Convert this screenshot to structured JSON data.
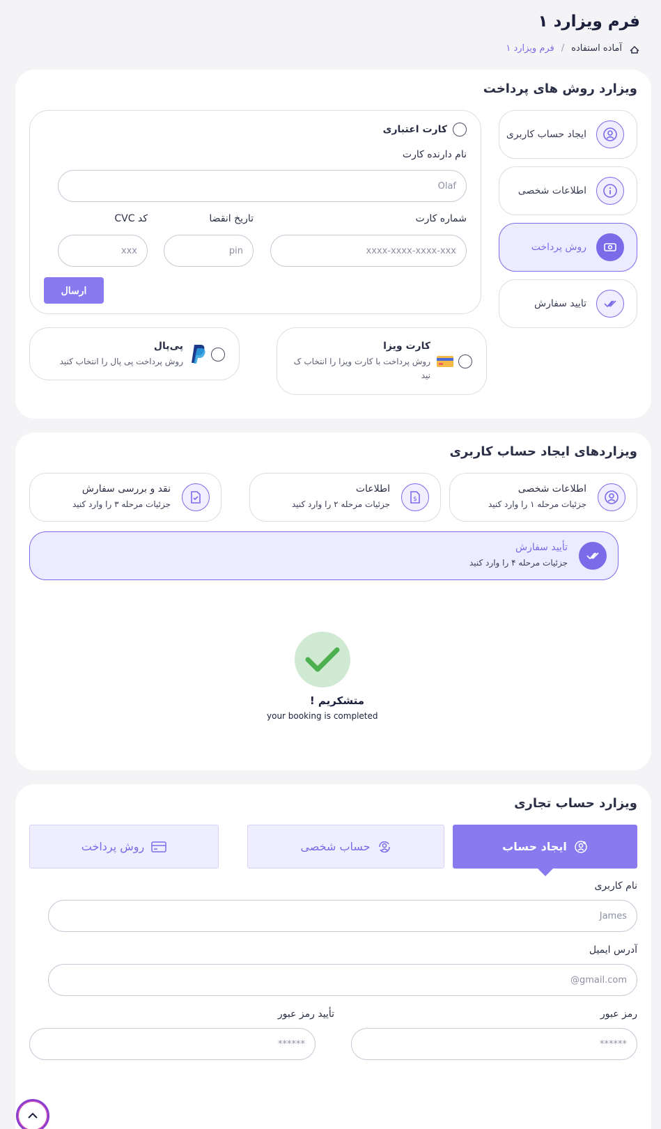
{
  "header": {
    "title": "فرم ویزارد ۱",
    "breadcrumb": {
      "home": "آماده استفاده",
      "separator": "/",
      "current": "فرم ویزارد ۱"
    }
  },
  "payment_wizard": {
    "title": "ویزارد روش های پرداخت",
    "steps": [
      {
        "label": "ایجاد حساب کاربری",
        "icon": "user-circle-icon"
      },
      {
        "label": "اطلاعات شخصی",
        "icon": "info-icon"
      },
      {
        "label": "روش پرداخت",
        "icon": "money-icon"
      },
      {
        "label": "تایید سفارش",
        "icon": "double-check-icon"
      }
    ],
    "active_step": 2,
    "credit_card": {
      "option_label": "کارت اعتباری",
      "holder_label": "نام دارنده کارت",
      "holder_placeholder": "Olaf",
      "number_label": "شماره کارت",
      "number_placeholder": "xxxx-xxxx-xxxx-xxx",
      "expiry_label": "تاریخ انقضا",
      "expiry_placeholder": "pin",
      "cvc_label": "کد CVC",
      "cvc_placeholder": "xxx",
      "submit_label": "ارسال"
    },
    "visa": {
      "title": "کارت ویزا",
      "desc_line1": "روش پرداخت با کارت ویزا را انتخاب ک",
      "desc_line2": "نید"
    },
    "paypal": {
      "title": "پی‌پال",
      "desc": "روش پرداخت پی پال را انتخاب کنید"
    }
  },
  "account_wizard": {
    "title": "ویزاردهای ایجاد حساب کاربری",
    "steps": [
      {
        "title": "اطلاعات شخصی",
        "desc": "جزئیات مرحله ۱ را وارد کنید",
        "icon": "user-circle-icon"
      },
      {
        "title": "اطلاعات",
        "desc": "جزئیات مرحله ۲ را وارد کنید",
        "icon": "dollar-file-icon"
      },
      {
        "title": "نقد و بررسی سفارش",
        "desc": "جزئیات مرحله ۳ را وارد کنید",
        "icon": "check-file-icon"
      },
      {
        "title": "تأیید سفارش",
        "desc": "جزئیات مرحله ۴ را وارد کنید",
        "icon": "double-check-icon"
      }
    ],
    "active_step": 3,
    "success_title": "متشکریم !",
    "success_desc": "your booking is completed"
  },
  "business_wizard": {
    "title": "ویزارد حساب تجاری",
    "tabs": [
      {
        "label": "ایجاد حساب",
        "icon": "user-add-icon"
      },
      {
        "label": "حساب شخصی",
        "icon": "user-sync-icon"
      },
      {
        "label": "روش پرداخت",
        "icon": "credit-card-icon"
      }
    ],
    "active_tab": 0,
    "username_label": "نام کاربری",
    "username_placeholder": "James",
    "email_label": "آدرس ایمیل",
    "email_placeholder": "@gmail.com",
    "password_label": "رمز عبور",
    "password_placeholder": "******",
    "confirm_label": "تأیید رمز عبور",
    "confirm_placeholder": "******"
  },
  "colors": {
    "accent": "#8a7af0",
    "accent_light": "#ecebff",
    "success": "#4caf50"
  }
}
